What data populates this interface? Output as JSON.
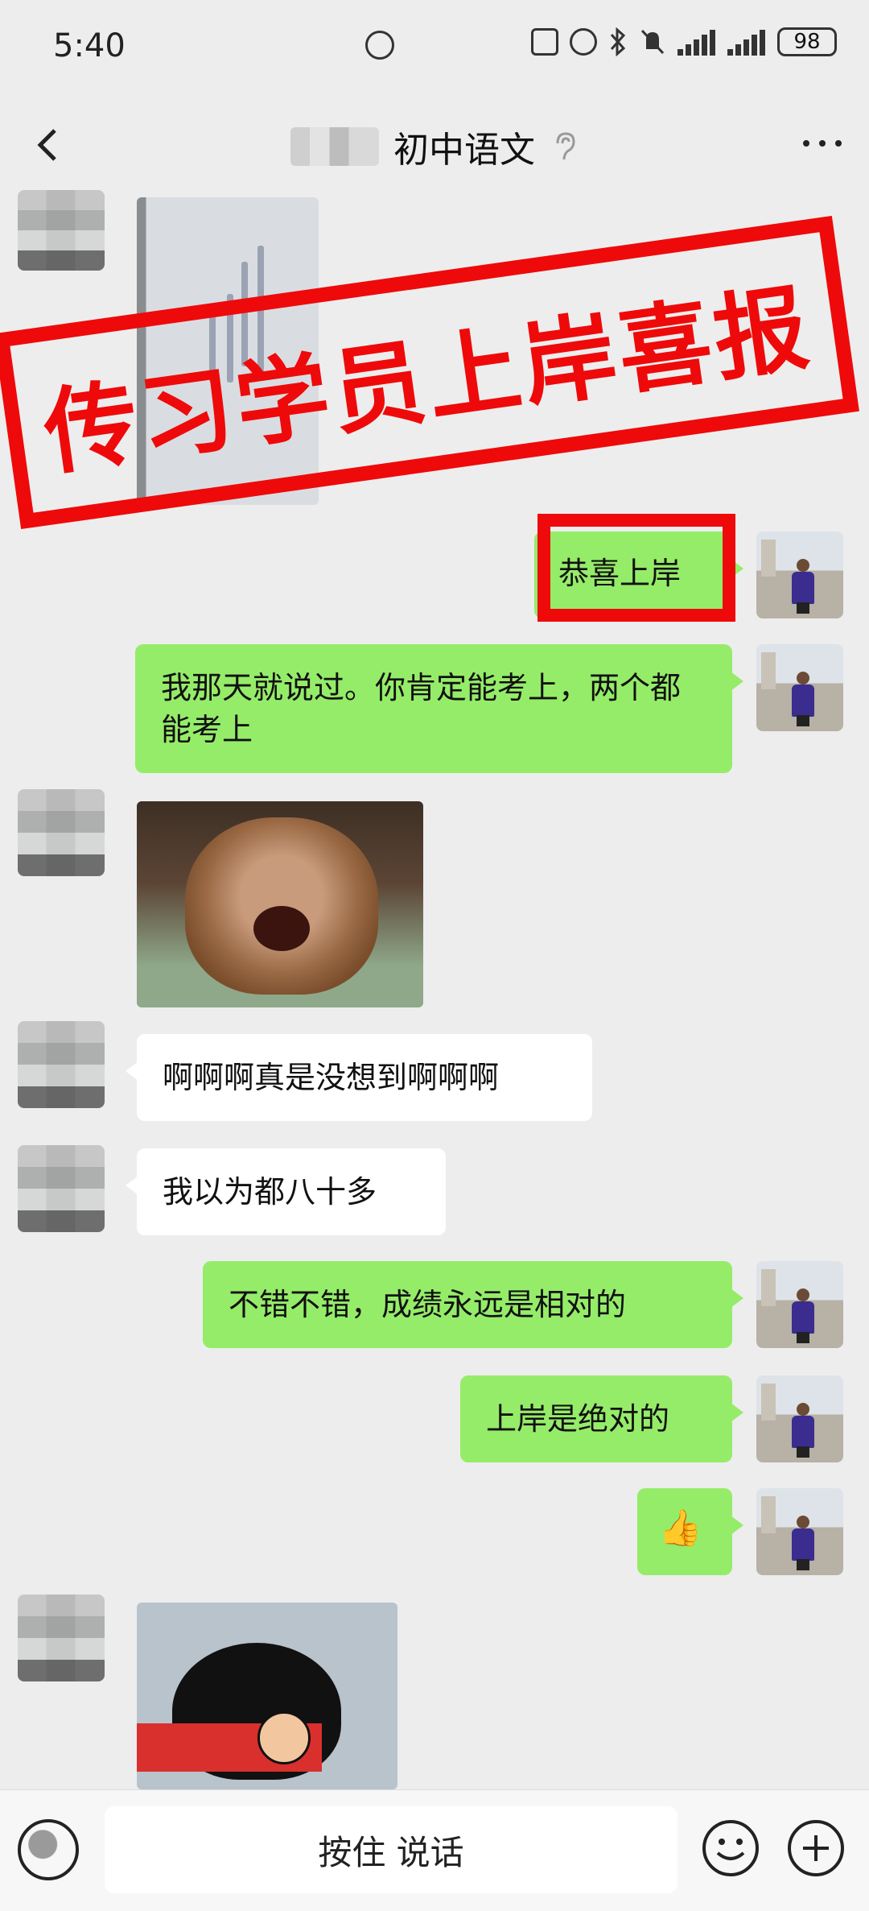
{
  "status_bar": {
    "time": "5:40",
    "battery": "98"
  },
  "nav": {
    "title": "初中语文"
  },
  "stamp": {
    "text": "传习学员上岸喜报"
  },
  "messages": {
    "m1": "恭喜上岸",
    "m2": "我那天就说过。你肯定能考上，两个都能考上",
    "m3": "啊啊啊真是没想到啊啊啊",
    "m4": "我以为都八十多",
    "m5": "不错不错，成绩永远是相对的",
    "m6": "上岸是绝对的",
    "m7": "👍"
  },
  "input_bar": {
    "hold_to_talk": "按住 说话"
  }
}
